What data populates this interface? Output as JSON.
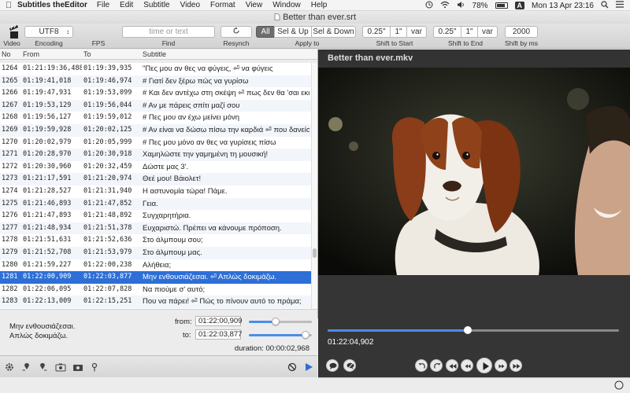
{
  "menubar": {
    "app_name": "Subtitles theEditor",
    "items": [
      "File",
      "Edit",
      "Subtitle",
      "Video",
      "Format",
      "View",
      "Window",
      "Help"
    ],
    "battery": "78%",
    "input_source": "A",
    "clock": "Mon 13 Apr  23:16"
  },
  "window": {
    "title": "Better than ever.srt"
  },
  "toolbar": {
    "video_label": "Video",
    "encoding_value": "UTF8",
    "encoding_label": "Encoding",
    "fps_label": "FPS",
    "find_placeholder": "time or text",
    "find_label": "Find",
    "resynch_label": "Resynch",
    "apply": {
      "options": [
        "All",
        "Sel & Up",
        "Sel & Down"
      ],
      "selected": "All",
      "label": "Apply to"
    },
    "shift_start": {
      "value": "0.25\"",
      "unit": "1\"",
      "mode": "var",
      "label": "Shift to Start"
    },
    "shift_end": {
      "value": "0.25\"",
      "unit": "1\"",
      "mode": "var",
      "label": "Shift to End"
    },
    "shift_ms": {
      "value": "2000",
      "label": "Shift by ms"
    }
  },
  "table": {
    "headers": {
      "no": "No",
      "from": "From",
      "to": "To",
      "subtitle": "Subtitle"
    },
    "rows": [
      {
        "no": "1264",
        "from": "01:21:19:36,488",
        "to": "01:19:39,935",
        "text": "\"Πες μου αν θες να φύγεις, ⏎ να φύγεις"
      },
      {
        "no": "1265",
        "from": "01:19:41,018",
        "to": "01:19:46,974",
        "text": "# Γιατί δεν ξέρω πώς να γυρίσω"
      },
      {
        "no": "1266",
        "from": "01:19:47,931",
        "to": "01:19:53,099",
        "text": "# Και δεν αντέχω στη σκέψη ⏎ πως δεν θα 'σαι εκεί"
      },
      {
        "no": "1267",
        "from": "01:19:53,129",
        "to": "01:19:56,044",
        "text": "# Αν με πάρεις σπίτι μαζί σου"
      },
      {
        "no": "1268",
        "from": "01:19:56,127",
        "to": "01:19:59,012",
        "text": "# Πες μου αν έχω μείνει μόνη"
      },
      {
        "no": "1269",
        "from": "01:19:59,928",
        "to": "01:20:02,125",
        "text": "# Αν είναι να δώσω πίσω την καρδιά ⏎ που δανείστηκα"
      },
      {
        "no": "1270",
        "from": "01:20:02,979",
        "to": "01:20:05,999",
        "text": "# Πες μου μόνο αν θες να γυρίσεις πίσω"
      },
      {
        "no": "1271",
        "from": "01:20:28,970",
        "to": "01:20:30,918",
        "text": "Χαμηλώστε την γαμημένη τη μουσική!"
      },
      {
        "no": "1272",
        "from": "01:20:30,960",
        "to": "01:20:32,459",
        "text": "Δώστε μας 3'."
      },
      {
        "no": "1273",
        "from": "01:21:17,591",
        "to": "01:21:20,974",
        "text": "Θεέ μου! Βάιολετ!"
      },
      {
        "no": "1274",
        "from": "01:21:28,527",
        "to": "01:21:31,940",
        "text": "Η αστυνομία τώρα! Πάμε."
      },
      {
        "no": "1275",
        "from": "01:21:46,893",
        "to": "01:21:47,852",
        "text": "Γεια."
      },
      {
        "no": "1276",
        "from": "01:21:47,893",
        "to": "01:21:48,892",
        "text": "Συγχαρητήρια."
      },
      {
        "no": "1277",
        "from": "01:21:48,934",
        "to": "01:21:51,378",
        "text": "Ευχαριστώ. Πρέπει να κάνουμε πρόποση."
      },
      {
        "no": "1278",
        "from": "01:21:51,631",
        "to": "01:21:52,636",
        "text": "Στο άλμπουμ σου;"
      },
      {
        "no": "1279",
        "from": "01:21:52,708",
        "to": "01:21:53,979",
        "text": "Στο άλμπουμ μας."
      },
      {
        "no": "1280",
        "from": "01:21:59,227",
        "to": "01:22:00,238",
        "text": "Αλήθεια;"
      },
      {
        "no": "1281",
        "from": "01:22:00,909",
        "to": "01:22:03,877",
        "text": "Μην ενθουσιάζεσαι. ⏎ Απλώς δοκιμάζω."
      },
      {
        "no": "1282",
        "from": "01:22:06,095",
        "to": "01:22:07,828",
        "text": "Να πιούμε σ' αυτό;"
      },
      {
        "no": "1283",
        "from": "01:22:13,009",
        "to": "01:22:15,251",
        "text": "Που να πάρει! ⏎ Πώς το πίνουν αυτό το πράμα;"
      }
    ],
    "selected_no": "1281"
  },
  "editor": {
    "text": "Μην ενθουσιάζεσαι.\nΑπλώς δοκιμάζω.",
    "from_label": "from:",
    "from_value": "01:22:00,909",
    "to_label": "to:",
    "to_value": "01:22:03,877",
    "duration": "duration: 00:00:02,968",
    "from_slider": 0.42,
    "to_slider": 0.9
  },
  "video": {
    "title": "Better than ever.mkv",
    "current_time": "01:22:04,902",
    "progress": 0.48
  },
  "colors": {
    "selection": "#2d6fd6",
    "accent": "#4d8ce8"
  }
}
